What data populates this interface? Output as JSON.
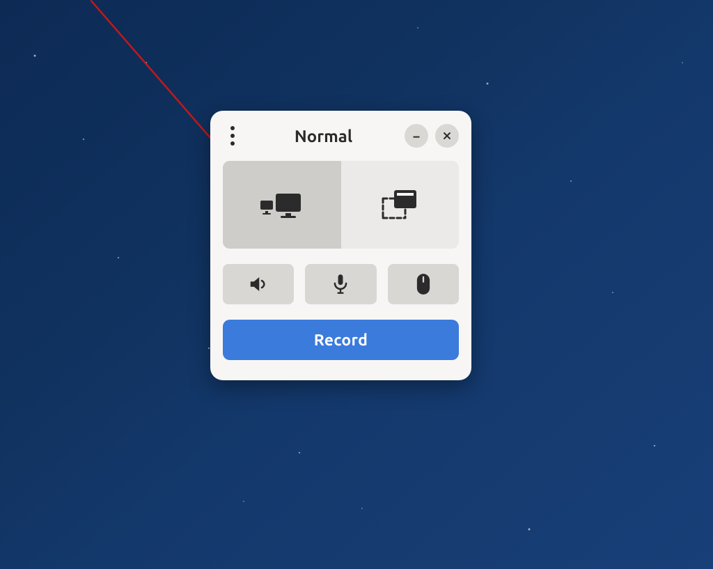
{
  "window": {
    "title": "Normal",
    "menu_icon": "kebab-menu-icon",
    "minimize_icon": "minimize-icon",
    "close_icon": "close-icon"
  },
  "modes": {
    "screen_icon": "screens-icon",
    "window_icon": "selection-window-icon",
    "active": "screen"
  },
  "options": {
    "sound_icon": "sound-icon",
    "mic_icon": "microphone-icon",
    "pointer_icon": "mouse-pointer-icon"
  },
  "actions": {
    "record_label": "Record"
  },
  "annotations": {
    "arrow": "pointer-arrow"
  },
  "colors": {
    "panel_bg": "#f7f6f5",
    "primary": "#3a7bdc",
    "opt_bg": "#d9d7d4",
    "mode_active": "#cfcdca",
    "mode_bg": "#eceae8",
    "text": "#2b2b2b",
    "arrow": "#c51818"
  }
}
